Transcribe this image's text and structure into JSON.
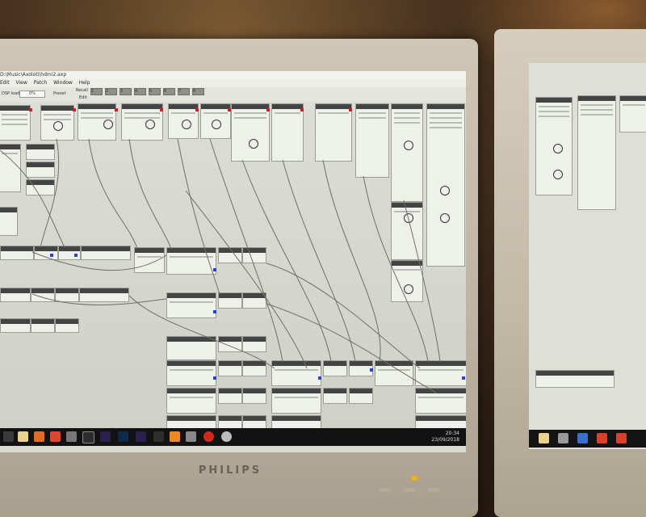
{
  "scene": "photo of two monitors showing a node-based audio patching application",
  "window": {
    "title": "D:\\Music\\Axoloti\\hdmi2.axp"
  },
  "menu": [
    "Edit",
    "View",
    "Patch",
    "Window",
    "Help"
  ],
  "toolbar": {
    "dsp_load": "DSP load",
    "percent": "0%",
    "preset": "Preset",
    "recall": "Recall",
    "edit": "Edit",
    "preset_numbers": [
      "1",
      "2",
      "3",
      "4",
      "5",
      "6",
      "7",
      "8"
    ]
  },
  "taskbar": {
    "time": "20:34",
    "date": "23/09/2018"
  },
  "monitor": {
    "brand": "PHILIPS"
  },
  "colors": {
    "port_red": "#d12020",
    "port_blue": "#2347c9",
    "led": "#ffb000"
  }
}
